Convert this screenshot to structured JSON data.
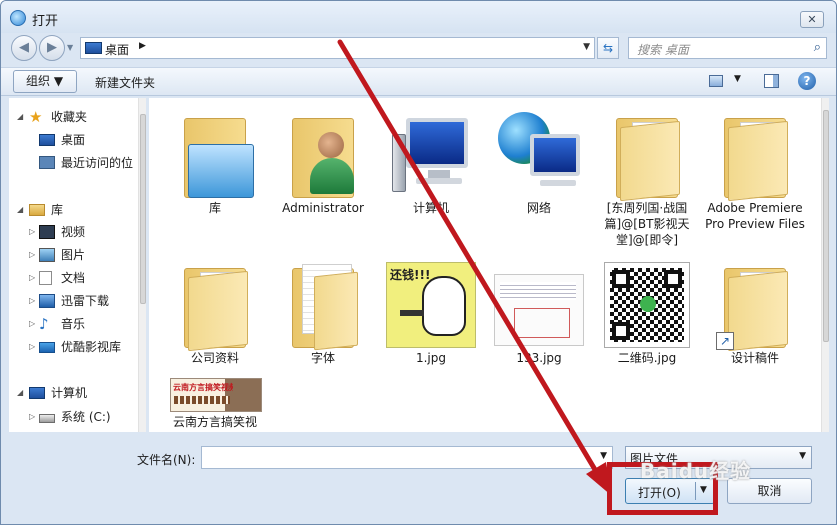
{
  "window": {
    "title": "打开",
    "close_glyph": "✕"
  },
  "nav": {
    "back_glyph": "◀",
    "forward_glyph": "▶",
    "address_location": "桌面",
    "address_chevron": "▶",
    "address_dropdown": "▼",
    "refresh_glyph": "⇆",
    "search_placeholder": "搜索 桌面",
    "search_glyph": "⌕"
  },
  "toolbar": {
    "organize_label": "组织 ▼",
    "new_folder_label": "新建文件夹",
    "view_dropdown": "▼",
    "help_glyph": "?"
  },
  "sidebar": {
    "favorites_label": "收藏夹",
    "favorites_items": [
      "桌面",
      "最近访问的位"
    ],
    "libraries_label": "库",
    "libraries_items": [
      "视频",
      "图片",
      "文档",
      "迅雷下载",
      "音乐",
      "优酷影视库"
    ],
    "computer_label": "计算机",
    "computer_items": [
      "系统 (C:)"
    ]
  },
  "files": [
    {
      "name": "库"
    },
    {
      "name": "Administrator"
    },
    {
      "name": "计算机"
    },
    {
      "name": "网络"
    },
    {
      "name": "[东周列国·战国篇]@[BT影视天堂]@[即令]"
    },
    {
      "name": "Adobe Premiere Pro Preview Files"
    },
    {
      "name": "公司资料"
    },
    {
      "name": "字体"
    },
    {
      "name": "1.jpg"
    },
    {
      "name": "133.jpg"
    },
    {
      "name": "二维码.jpg"
    },
    {
      "name": "设计稿件"
    },
    {
      "name": "云南方言搞笑视"
    }
  ],
  "thumbnails": {
    "meme_text": "还钱!!!",
    "banner_text": "云南方言搞笑视频"
  },
  "footer": {
    "filename_label": "文件名(N):",
    "filename_value": "",
    "filename_dropdown": "▼",
    "filter_label": "图片文件",
    "filter_dropdown": "▼",
    "open_label": "打开(O)",
    "open_dropdown": "▼",
    "cancel_label": "取消"
  },
  "watermark": "Baidu经验",
  "colors": {
    "annotation": "#c0181e",
    "accent": "#2a73c2"
  }
}
